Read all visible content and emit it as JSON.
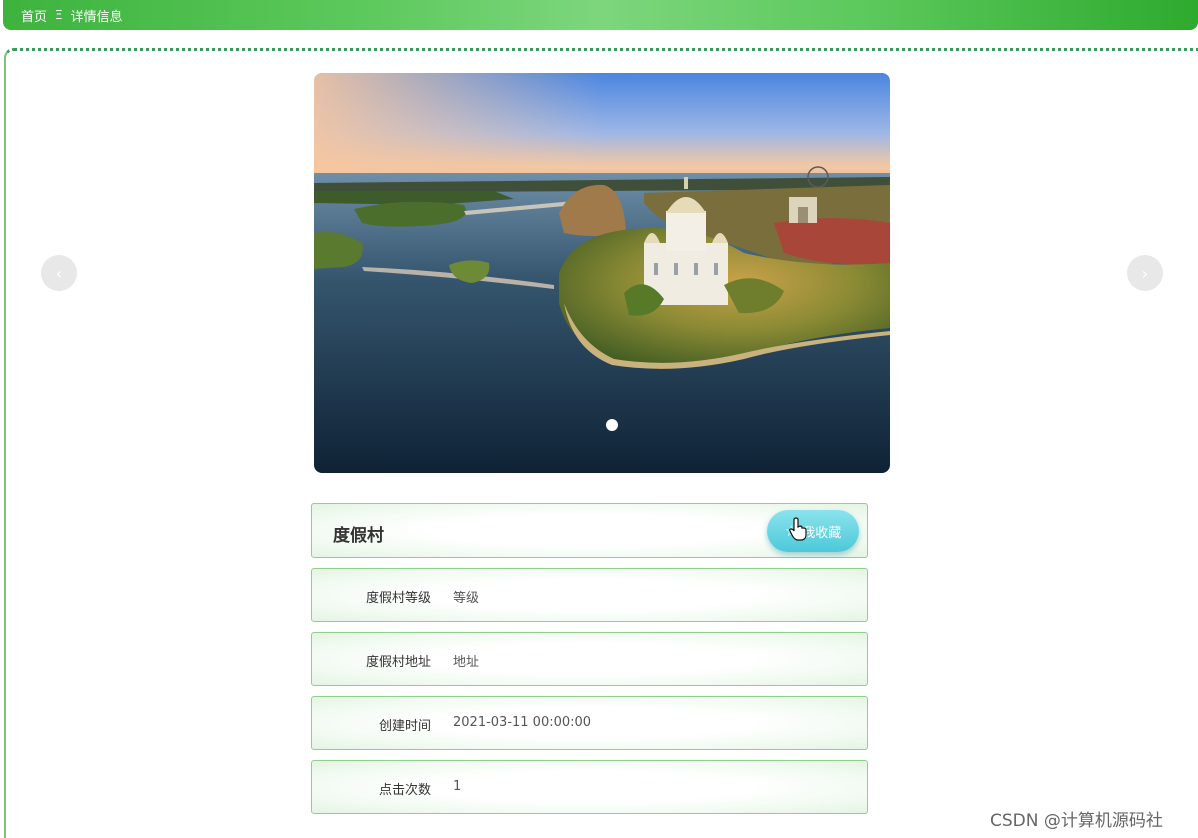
{
  "breadcrumb": {
    "home": "首页",
    "separator": "Ξ",
    "current": "详情信息"
  },
  "carousel": {
    "prev_icon": "‹",
    "next_icon": "›",
    "slide_image": "aerial resort lake with castle island",
    "dot_count": 1
  },
  "detail": {
    "title": "度假村",
    "favorite_button": {
      "icon": "☆",
      "label": "我收藏"
    },
    "fields": [
      {
        "label": "度假村等级",
        "value": "等级"
      },
      {
        "label": "度假村地址",
        "value": "地址"
      },
      {
        "label": "创建时间",
        "value": "2021-03-11 00:00:00"
      },
      {
        "label": "点击次数",
        "value": "1"
      }
    ]
  },
  "watermark": "CSDN @计算机源码社",
  "colors": {
    "brand_green": "#3db33d",
    "panel_border": "#8fd08f",
    "favorite_button": "#4cc9d9"
  }
}
